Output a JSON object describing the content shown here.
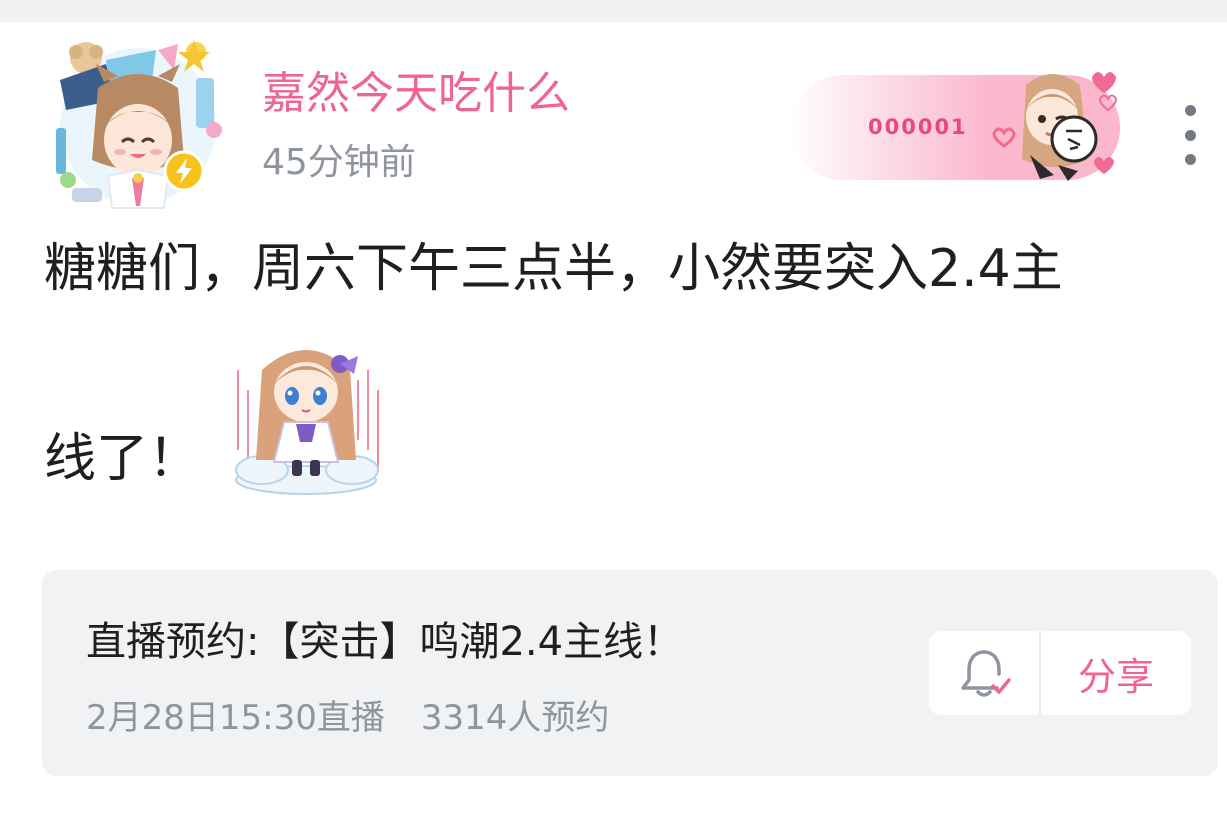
{
  "author": {
    "name": "嘉然今天吃什么",
    "time": "45分钟前",
    "avatar_icon": "vtuber-avatar-icon",
    "verified_icon": "lightning-badge-icon"
  },
  "fan_badge": {
    "number": "000001",
    "art_icon": "fan-badge-character-icon"
  },
  "post": {
    "line1": "糖糖们，周六下午三点半，小然要突入2.4主",
    "line2": "线了！",
    "emote_icon": "chibi-character-emote-icon"
  },
  "reservation": {
    "title": "直播预约:【突击】鸣潮2.4主线！",
    "datetime": "2月28日15:30直播",
    "count": "3314人预约",
    "bell_icon": "bell-check-icon",
    "share_label": "分享"
  },
  "colors": {
    "accent_pink": "#f0658f",
    "badge_pink": "#fbb8cd",
    "muted_text": "#8e959e",
    "card_bg": "#f1f2f4",
    "verified_yellow": "#f7c21a"
  }
}
